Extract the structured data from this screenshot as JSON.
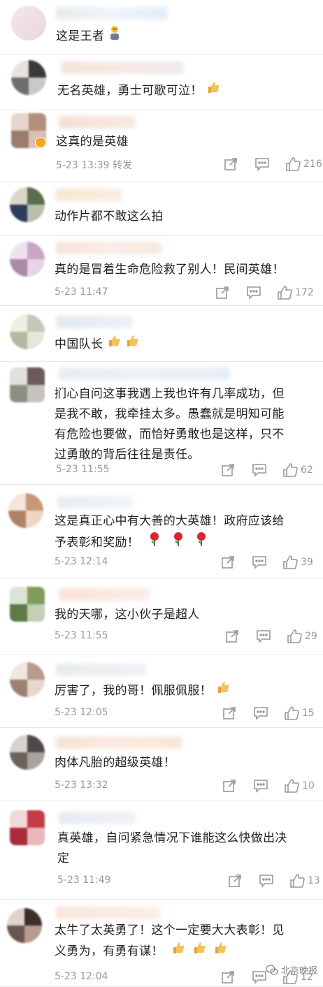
{
  "comments": [
    {
      "text_lines": [
        "这是王者"
      ],
      "emoji_after": "trophy-man",
      "time": "",
      "action": "",
      "likes": ""
    },
    {
      "text_lines": [
        "无名英雄，勇士可歌可泣！"
      ],
      "emoji_after": "thumbs-up",
      "time": "",
      "action": "",
      "likes": ""
    },
    {
      "text_lines": [
        "这真的是英雄"
      ],
      "emoji_after": "",
      "time": "5-23 13:39",
      "action": "转发",
      "likes": "216"
    },
    {
      "text_lines": [
        "动作片都不敢这么拍"
      ],
      "emoji_after": "",
      "time": "",
      "action": "",
      "likes": ""
    },
    {
      "text_lines": [
        "真的是冒着生命危险救了别人！民间英雄！"
      ],
      "emoji_after": "",
      "time": "5-23 11:47",
      "action": "",
      "likes": "172"
    },
    {
      "text_lines": [
        "中国队长"
      ],
      "emoji_after": "thumbs-up x2",
      "time": "",
      "action": "",
      "likes": ""
    },
    {
      "text_lines": [
        "扪心自问这事我遇上我也许有几率成功，但",
        "是我不敢，我牵挂太多。愚蠢就是明知可能",
        "有危险也要做，而恰好勇敢也是这样，只不",
        "过勇敢的背后往往是责任。"
      ],
      "emoji_after": "",
      "time": "5-23 11:55",
      "action": "",
      "likes": "62"
    },
    {
      "text_lines": [
        "这是真正心中有大善的大英雄！政府应该给",
        "予表彰和奖励！"
      ],
      "emoji_after": "rose x3",
      "time": "5-23 12:14",
      "action": "",
      "likes": "39"
    },
    {
      "text_lines": [
        "我的天哪，这小伙子是超人"
      ],
      "emoji_after": "",
      "time": "5-23 11:55",
      "action": "",
      "likes": "29"
    },
    {
      "text_lines": [
        "厉害了，我的哥！佩服佩服！"
      ],
      "emoji_after": "thumbs-up",
      "time": "5-23 12:05",
      "action": "",
      "likes": "15"
    },
    {
      "text_lines": [
        "肉体凡胎的超级英雄！"
      ],
      "emoji_after": "",
      "time": "5-23 13:32",
      "action": "",
      "likes": "10"
    },
    {
      "text_lines": [
        "真英雄，自问紧急情况下谁能这么快做出决",
        "定"
      ],
      "emoji_after": "",
      "time": "5-23 11:49",
      "action": "",
      "likes": "13"
    },
    {
      "text_lines": [
        "太牛了太英勇了！这个一定要大大表彰！见",
        "义勇为，有勇有谋！"
      ],
      "emoji_after": "thumbs-up x3",
      "time": "5-23 12:04",
      "action": "",
      "likes": "12"
    }
  ],
  "watermark": "北京晚报",
  "icons": {
    "share": "share-icon",
    "reply": "comment-icon",
    "like": "thumbs-up-icon",
    "watermark": "wechat-icon"
  },
  "colors": {
    "background": "#ffffff",
    "meta": "#999999",
    "text": "#222222"
  }
}
